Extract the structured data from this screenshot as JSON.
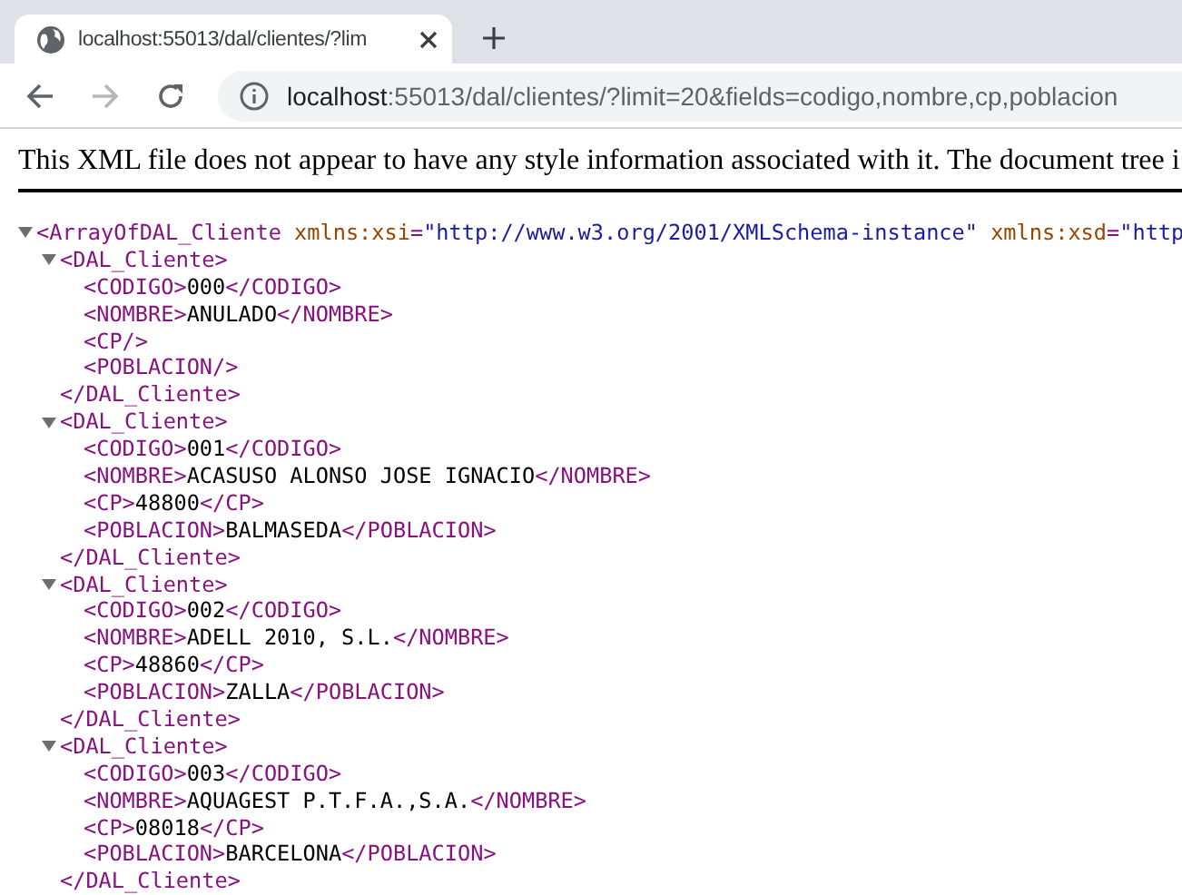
{
  "tab": {
    "title": "localhost:55013/dal/clientes/?lim",
    "selected": true
  },
  "address_bar": {
    "url_host": "localhost",
    "url_rest": ":55013/dal/clientes/?limit=20&fields=codigo,nombre,cp,poblacion"
  },
  "notice": "This XML file does not appear to have any style information associated with it. The document tree i",
  "xml": {
    "open": "<ArrayOfDAL_Cliente",
    "expanded": true,
    "attributes": [
      {
        "name": "xmlns:xsi",
        "eq": "=",
        "value": "\"http://www.w3.org/2001/XMLSchema-instance\""
      },
      {
        "name": "xmlns:xsd",
        "eq": "=",
        "value": "\"http"
      }
    ],
    "children": [
      {
        "open": "<DAL_Cliente>",
        "expanded": true,
        "close": "</DAL_Cliente>",
        "fields": [
          {
            "open": "<CODIGO>",
            "text": "000",
            "close": "</CODIGO>"
          },
          {
            "open": "<NOMBRE>",
            "text": "ANULADO",
            "close": "</NOMBRE>"
          },
          {
            "open": "<CP/>"
          },
          {
            "open": "<POBLACION/>"
          }
        ]
      },
      {
        "open": "<DAL_Cliente>",
        "expanded": true,
        "close": "</DAL_Cliente>",
        "fields": [
          {
            "open": "<CODIGO>",
            "text": "001",
            "close": "</CODIGO>"
          },
          {
            "open": "<NOMBRE>",
            "text": "ACASUSO ALONSO JOSE IGNACIO",
            "close": "</NOMBRE>"
          },
          {
            "open": "<CP>",
            "text": "48800",
            "close": "</CP>"
          },
          {
            "open": "<POBLACION>",
            "text": "BALMASEDA",
            "close": "</POBLACION>"
          }
        ]
      },
      {
        "open": "<DAL_Cliente>",
        "expanded": true,
        "close": "</DAL_Cliente>",
        "fields": [
          {
            "open": "<CODIGO>",
            "text": "002",
            "close": "</CODIGO>"
          },
          {
            "open": "<NOMBRE>",
            "text": "ADELL 2010, S.L.",
            "close": "</NOMBRE>"
          },
          {
            "open": "<CP>",
            "text": "48860",
            "close": "</CP>"
          },
          {
            "open": "<POBLACION>",
            "text": "ZALLA",
            "close": "</POBLACION>"
          }
        ]
      },
      {
        "open": "<DAL_Cliente>",
        "expanded": true,
        "close": "</DAL_Cliente>",
        "fields": [
          {
            "open": "<CODIGO>",
            "text": "003",
            "close": "</CODIGO>"
          },
          {
            "open": "<NOMBRE>",
            "text": "AQUAGEST P.T.F.A.,S.A.",
            "close": "</NOMBRE>"
          },
          {
            "open": "<CP>",
            "text": "08018",
            "close": "</CP>"
          },
          {
            "open": "<POBLACION>",
            "text": "BARCELONA",
            "close": "</POBLACION>"
          }
        ]
      }
    ]
  }
}
